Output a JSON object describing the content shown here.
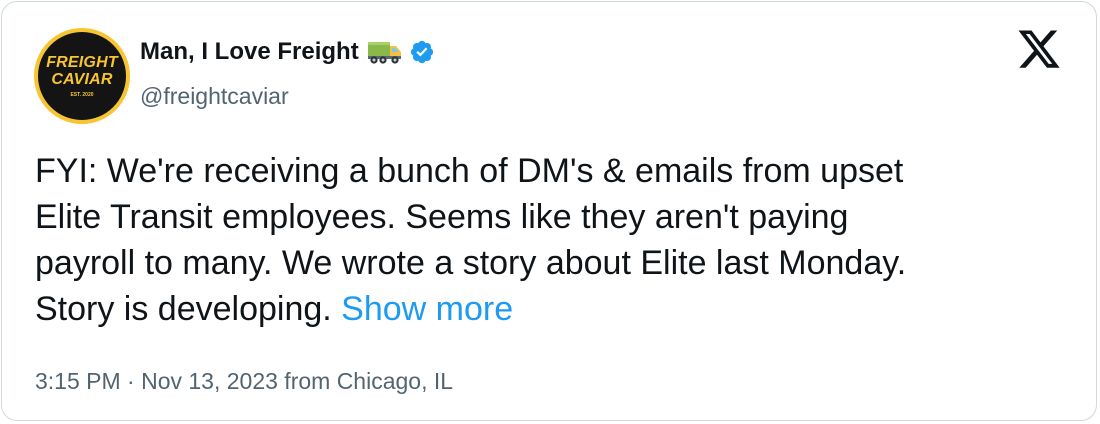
{
  "account": {
    "display_name": "Man, I Love Freight",
    "handle": "@freightcaviar",
    "avatar_logo": {
      "line1": "FREIGHT",
      "line2": "CAVIAR",
      "est": "EST. 2020"
    },
    "icons": [
      "truck-icon",
      "verified-badge-icon"
    ]
  },
  "brand_icon": "x-logo-icon",
  "tweet": {
    "text": "FYI: We're receiving a bunch of DM's & emails from upset\nElite Transit employees. Seems like they aren't paying\npayroll to many. We wrote a story about Elite last Monday.\nStory is developing. ",
    "show_more_label": "Show more"
  },
  "timestamp": "3:15 PM · Nov 13, 2023 from Chicago, IL",
  "colors": {
    "text": "#0f1419",
    "secondary": "#536471",
    "link": "#1d9bf0",
    "verified": "#1d9bf0",
    "avatar_ring": "#f7c531",
    "avatar_bg": "#141414",
    "card_border": "#cfd9de"
  }
}
